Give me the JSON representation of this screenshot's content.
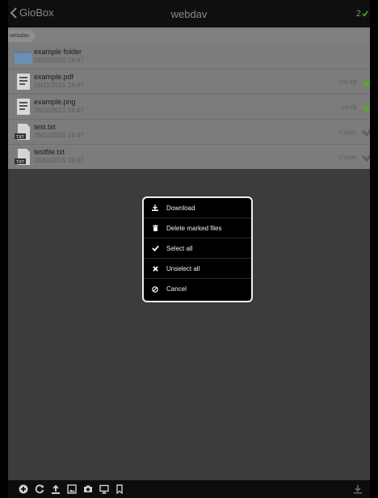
{
  "navbar": {
    "back_label": "GioBox",
    "title": "webdav",
    "count": "2"
  },
  "breadcrumb": {
    "item": "webdav"
  },
  "files": [
    {
      "name": "example folder",
      "date": "26/11/2015 18:47",
      "size": "",
      "type": "folder-icon",
      "checked": false
    },
    {
      "name": "example.pdf",
      "date": "26/11/2015 18:47",
      "size": "175 KB",
      "type": "pdf-file-icon",
      "checked": true
    },
    {
      "name": "example.png",
      "date": "26/11/2015 18:47",
      "size": "19 KB",
      "type": "image-file-icon",
      "checked": true
    },
    {
      "name": "test.txt",
      "date": "26/11/2015 18:47",
      "size": "0 bytes",
      "type": "txt-file-icon",
      "checked": false
    },
    {
      "name": "testfile.txt",
      "date": "26/11/2015 18:47",
      "size": "0 bytes",
      "type": "txt-file-icon",
      "checked": false
    }
  ],
  "menu": {
    "items": [
      {
        "label": "Download",
        "icon": "download-icon"
      },
      {
        "label": "Delete marked files",
        "icon": "trash-icon"
      },
      {
        "label": "Select all",
        "icon": "checkmark-icon"
      },
      {
        "label": "Unselect all",
        "icon": "x-icon"
      },
      {
        "label": "Cancel",
        "icon": "cancel-icon"
      }
    ]
  },
  "toolbar": {
    "buttons": [
      "add-icon",
      "refresh-icon",
      "upload-icon",
      "image-icon",
      "camera-icon",
      "monitor-icon",
      "bookmark-icon",
      "download-icon"
    ]
  },
  "colors": {
    "check_green": "#4caf2a",
    "check_gray": "#5f5f5f",
    "folder_blue": "#5a7ea0"
  }
}
